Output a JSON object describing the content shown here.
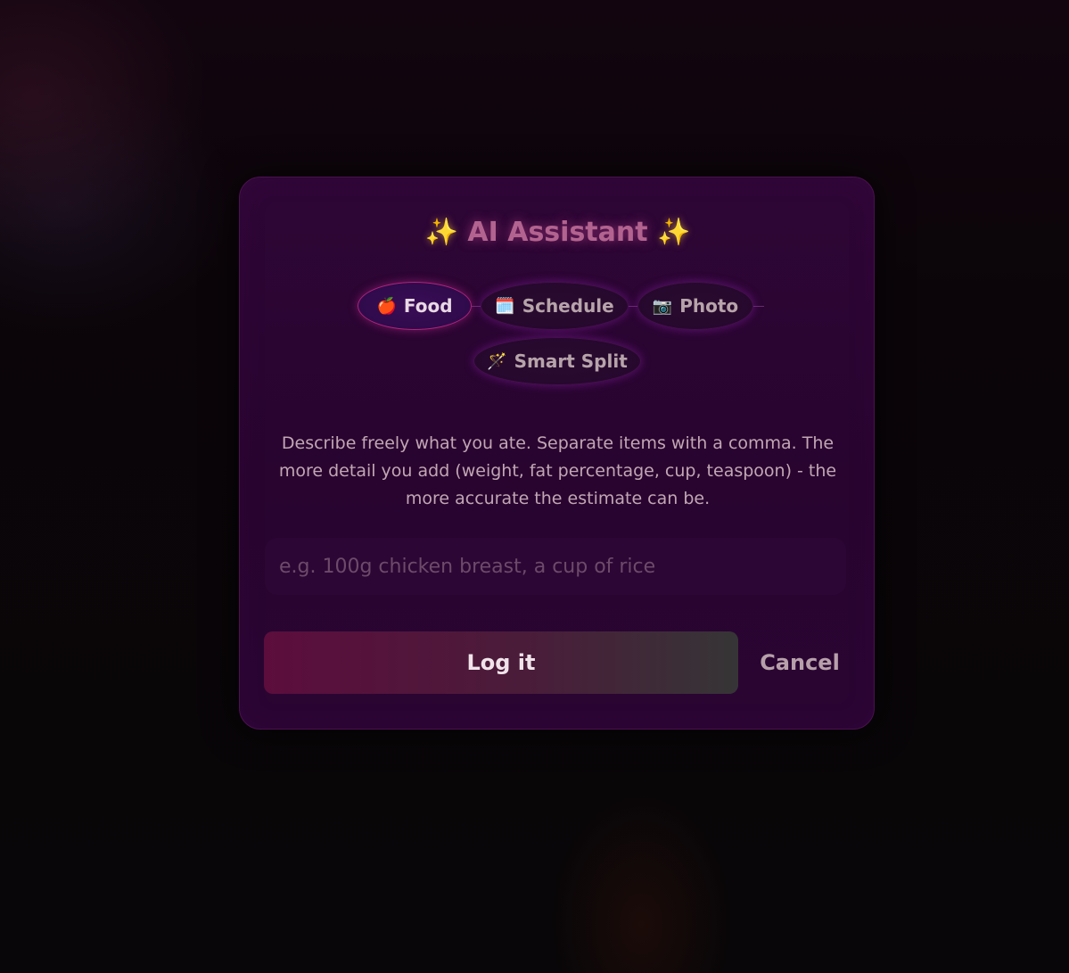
{
  "modal": {
    "title": "AI Assistant",
    "title_left_icon": "✨",
    "title_right_icon": "✨",
    "tabs": [
      {
        "icon": "🍎",
        "icon_name": "apple-icon",
        "label": "Food",
        "active": true
      },
      {
        "icon": "🗓️",
        "icon_name": "calendar-icon",
        "label": "Schedule",
        "active": false
      },
      {
        "icon": "📷",
        "icon_name": "camera-icon",
        "label": "Photo",
        "active": false
      },
      {
        "icon": "🪄",
        "icon_name": "magic-wand-icon",
        "label": "Smart Split",
        "active": false
      }
    ],
    "description": "Describe freely what you ate. Separate items with a comma. The more detail you add (weight, fat percentage, cup, teaspoon) - the more accurate the estimate can be.",
    "input": {
      "value": "",
      "placeholder": "e.g. 100g chicken breast, a cup of rice"
    },
    "primary_button": "Log it",
    "secondary_button": "Cancel"
  },
  "colors": {
    "accent_pink": "#b0247a",
    "modal_bg": "#2e0636",
    "title_color": "#b3638f"
  }
}
